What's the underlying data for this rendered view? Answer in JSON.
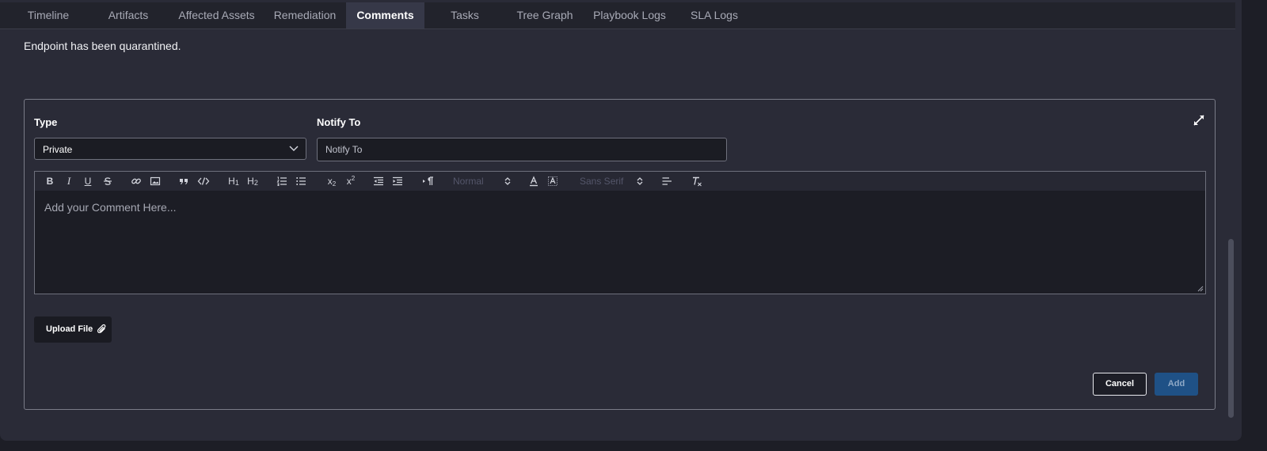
{
  "tabs": [
    {
      "label": "Timeline",
      "active": false
    },
    {
      "label": "Artifacts",
      "active": false
    },
    {
      "label": "Affected Assets",
      "active": false
    },
    {
      "label": "Remediation",
      "active": false
    },
    {
      "label": "Comments",
      "active": true
    },
    {
      "label": "Tasks",
      "active": false
    },
    {
      "label": "Tree Graph",
      "active": false
    },
    {
      "label": "Playbook Logs",
      "active": false
    },
    {
      "label": "SLA Logs",
      "active": false
    }
  ],
  "previous_comment": "Endpoint has been quarantined.",
  "form": {
    "type_label": "Type",
    "type_value": "Private",
    "notify_label": "Notify To",
    "notify_placeholder": "Notify To",
    "editor": {
      "placeholder": "Add your Comment Here...",
      "toolbar": {
        "bold": "B",
        "italic": "I",
        "underline": "U",
        "h1": "H",
        "h1_sub": "1",
        "h2": "H",
        "h2_sub": "2",
        "subscript": "x",
        "subscript_mark": "2",
        "superscript": "x",
        "superscript_mark": "2",
        "size_value": "Normal",
        "font_value": "Sans Serif"
      }
    },
    "upload_label": "Upload File",
    "cancel_label": "Cancel",
    "add_label": "Add"
  },
  "colors": {
    "background": "#2a2b37",
    "add_button": "#1f5186"
  }
}
